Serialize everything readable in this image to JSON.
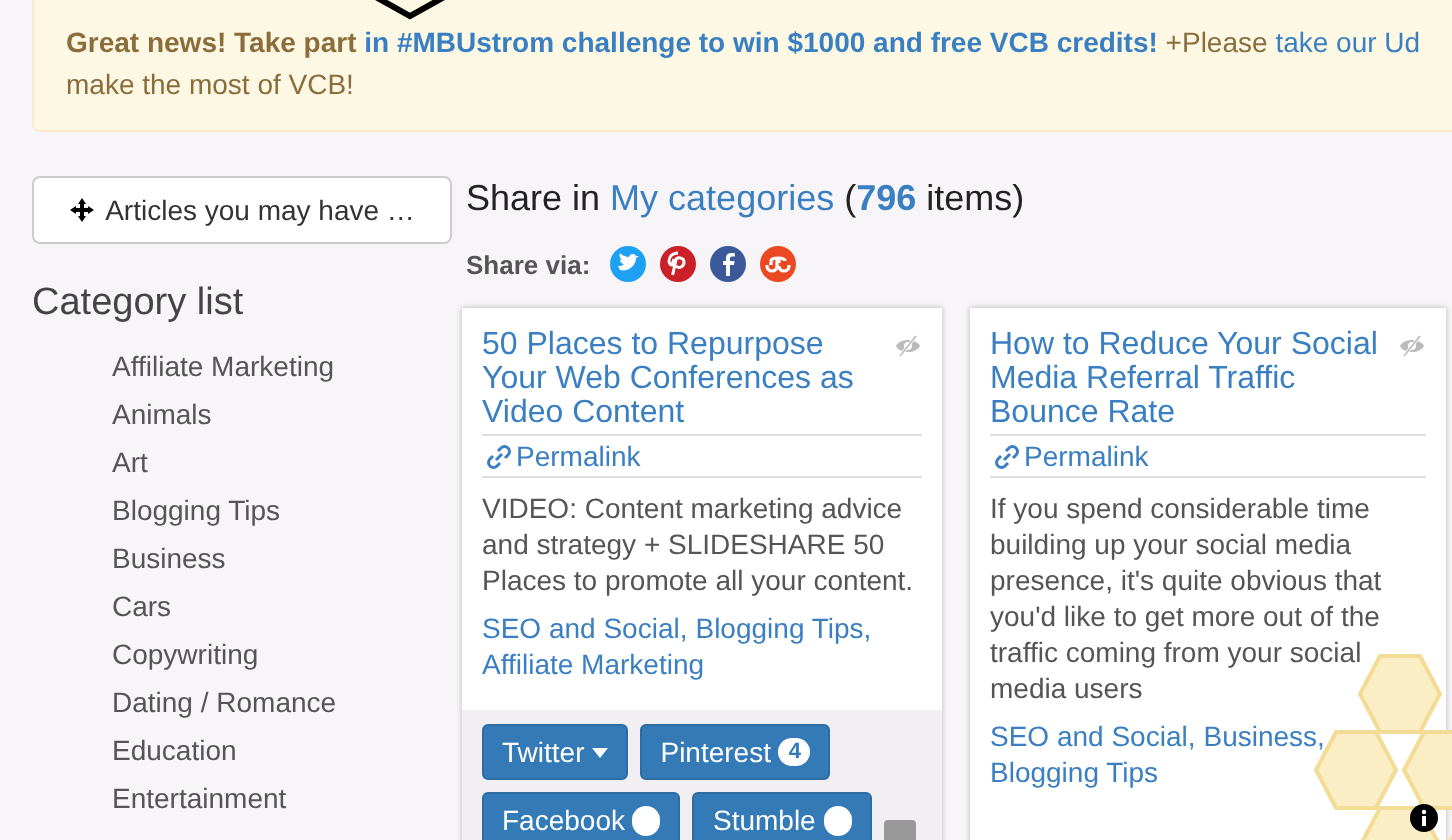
{
  "banner": {
    "lead": "Great news! Take part",
    "link": "in #MBUstrom challenge to win $1000 and free VCB credits!",
    "text": "+Please",
    "link2": "take our Ud",
    "line2": "make the most of VCB!"
  },
  "sidebar": {
    "button": "Articles you may have …",
    "heading": "Category list",
    "categories": [
      "Affiliate Marketing",
      "Animals",
      "Art",
      "Blogging Tips",
      "Business",
      "Cars",
      "Copywriting",
      "Dating / Romance",
      "Education",
      "Entertainment"
    ]
  },
  "share": {
    "parts": [
      {
        "kind": "plain",
        "text": "Share in "
      },
      {
        "kind": "link",
        "text": "My categories"
      },
      {
        "kind": "plain",
        "text": " ("
      },
      {
        "kind": "count",
        "text": "796"
      },
      {
        "kind": "plain",
        "text": " items)"
      }
    ],
    "via_label": "Share via:",
    "networks": [
      {
        "kind": "twitter"
      },
      {
        "kind": "pinterest"
      },
      {
        "kind": "facebook"
      },
      {
        "kind": "stumbleupon"
      }
    ]
  },
  "cards": [
    {
      "title": "50 Places to Repurpose Your Web Conferences as Video Content",
      "permalink": "Permalink",
      "description": "VIDEO: Content marketing advice and strategy + SLIDESHARE 50 Places to promote all your content.",
      "tags": [
        "SEO and Social,",
        "Blogging Tips,",
        "Affiliate Marketing"
      ],
      "buttons": [
        {
          "label": "Twitter",
          "kind": "dropdown"
        },
        {
          "label": "Pinterest",
          "kind": "count",
          "count": "4"
        },
        {
          "label": "Facebook",
          "kind": "badge"
        },
        {
          "label": "Stumble",
          "kind": "badge"
        },
        {
          "kind": "more"
        }
      ]
    },
    {
      "title": "How to Reduce Your Social Media Referral Traffic Bounce Rate",
      "permalink": "Permalink",
      "description": "If you spend considerable time building up your social media presence, it's quite obvious that you'd like to get more out of the traffic coming from your social media users",
      "tags": [
        "SEO and Social,",
        "Business,",
        "Blogging Tips"
      ]
    }
  ]
}
